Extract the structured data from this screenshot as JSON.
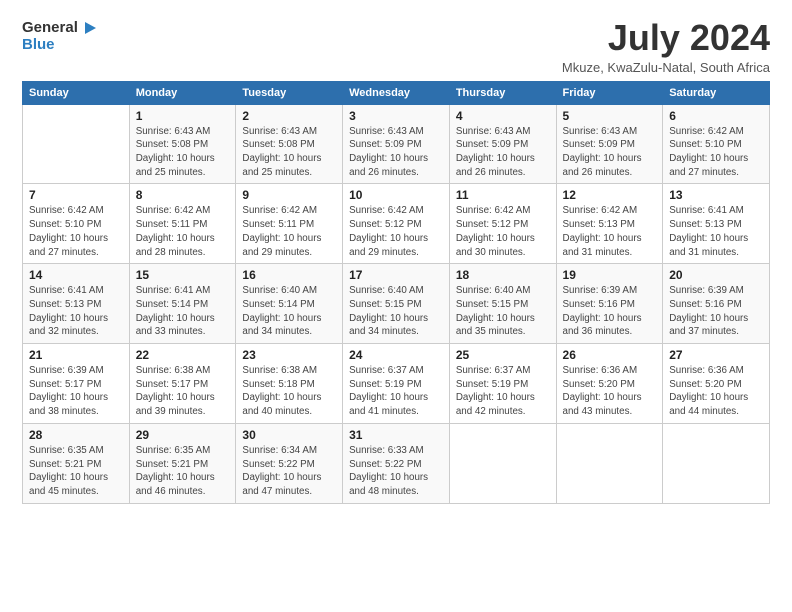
{
  "logo": {
    "line1": "General",
    "line2": "Blue",
    "arrow_color": "#2d7fc1"
  },
  "title": "July 2024",
  "subtitle": "Mkuze, KwaZulu-Natal, South Africa",
  "days_of_week": [
    "Sunday",
    "Monday",
    "Tuesday",
    "Wednesday",
    "Thursday",
    "Friday",
    "Saturday"
  ],
  "weeks": [
    [
      {
        "num": "",
        "info": ""
      },
      {
        "num": "1",
        "info": "Sunrise: 6:43 AM\nSunset: 5:08 PM\nDaylight: 10 hours\nand 25 minutes."
      },
      {
        "num": "2",
        "info": "Sunrise: 6:43 AM\nSunset: 5:08 PM\nDaylight: 10 hours\nand 25 minutes."
      },
      {
        "num": "3",
        "info": "Sunrise: 6:43 AM\nSunset: 5:09 PM\nDaylight: 10 hours\nand 26 minutes."
      },
      {
        "num": "4",
        "info": "Sunrise: 6:43 AM\nSunset: 5:09 PM\nDaylight: 10 hours\nand 26 minutes."
      },
      {
        "num": "5",
        "info": "Sunrise: 6:43 AM\nSunset: 5:09 PM\nDaylight: 10 hours\nand 26 minutes."
      },
      {
        "num": "6",
        "info": "Sunrise: 6:42 AM\nSunset: 5:10 PM\nDaylight: 10 hours\nand 27 minutes."
      }
    ],
    [
      {
        "num": "7",
        "info": "Sunrise: 6:42 AM\nSunset: 5:10 PM\nDaylight: 10 hours\nand 27 minutes."
      },
      {
        "num": "8",
        "info": "Sunrise: 6:42 AM\nSunset: 5:11 PM\nDaylight: 10 hours\nand 28 minutes."
      },
      {
        "num": "9",
        "info": "Sunrise: 6:42 AM\nSunset: 5:11 PM\nDaylight: 10 hours\nand 29 minutes."
      },
      {
        "num": "10",
        "info": "Sunrise: 6:42 AM\nSunset: 5:12 PM\nDaylight: 10 hours\nand 29 minutes."
      },
      {
        "num": "11",
        "info": "Sunrise: 6:42 AM\nSunset: 5:12 PM\nDaylight: 10 hours\nand 30 minutes."
      },
      {
        "num": "12",
        "info": "Sunrise: 6:42 AM\nSunset: 5:13 PM\nDaylight: 10 hours\nand 31 minutes."
      },
      {
        "num": "13",
        "info": "Sunrise: 6:41 AM\nSunset: 5:13 PM\nDaylight: 10 hours\nand 31 minutes."
      }
    ],
    [
      {
        "num": "14",
        "info": "Sunrise: 6:41 AM\nSunset: 5:13 PM\nDaylight: 10 hours\nand 32 minutes."
      },
      {
        "num": "15",
        "info": "Sunrise: 6:41 AM\nSunset: 5:14 PM\nDaylight: 10 hours\nand 33 minutes."
      },
      {
        "num": "16",
        "info": "Sunrise: 6:40 AM\nSunset: 5:14 PM\nDaylight: 10 hours\nand 34 minutes."
      },
      {
        "num": "17",
        "info": "Sunrise: 6:40 AM\nSunset: 5:15 PM\nDaylight: 10 hours\nand 34 minutes."
      },
      {
        "num": "18",
        "info": "Sunrise: 6:40 AM\nSunset: 5:15 PM\nDaylight: 10 hours\nand 35 minutes."
      },
      {
        "num": "19",
        "info": "Sunrise: 6:39 AM\nSunset: 5:16 PM\nDaylight: 10 hours\nand 36 minutes."
      },
      {
        "num": "20",
        "info": "Sunrise: 6:39 AM\nSunset: 5:16 PM\nDaylight: 10 hours\nand 37 minutes."
      }
    ],
    [
      {
        "num": "21",
        "info": "Sunrise: 6:39 AM\nSunset: 5:17 PM\nDaylight: 10 hours\nand 38 minutes."
      },
      {
        "num": "22",
        "info": "Sunrise: 6:38 AM\nSunset: 5:17 PM\nDaylight: 10 hours\nand 39 minutes."
      },
      {
        "num": "23",
        "info": "Sunrise: 6:38 AM\nSunset: 5:18 PM\nDaylight: 10 hours\nand 40 minutes."
      },
      {
        "num": "24",
        "info": "Sunrise: 6:37 AM\nSunset: 5:19 PM\nDaylight: 10 hours\nand 41 minutes."
      },
      {
        "num": "25",
        "info": "Sunrise: 6:37 AM\nSunset: 5:19 PM\nDaylight: 10 hours\nand 42 minutes."
      },
      {
        "num": "26",
        "info": "Sunrise: 6:36 AM\nSunset: 5:20 PM\nDaylight: 10 hours\nand 43 minutes."
      },
      {
        "num": "27",
        "info": "Sunrise: 6:36 AM\nSunset: 5:20 PM\nDaylight: 10 hours\nand 44 minutes."
      }
    ],
    [
      {
        "num": "28",
        "info": "Sunrise: 6:35 AM\nSunset: 5:21 PM\nDaylight: 10 hours\nand 45 minutes."
      },
      {
        "num": "29",
        "info": "Sunrise: 6:35 AM\nSunset: 5:21 PM\nDaylight: 10 hours\nand 46 minutes."
      },
      {
        "num": "30",
        "info": "Sunrise: 6:34 AM\nSunset: 5:22 PM\nDaylight: 10 hours\nand 47 minutes."
      },
      {
        "num": "31",
        "info": "Sunrise: 6:33 AM\nSunset: 5:22 PM\nDaylight: 10 hours\nand 48 minutes."
      },
      {
        "num": "",
        "info": ""
      },
      {
        "num": "",
        "info": ""
      },
      {
        "num": "",
        "info": ""
      }
    ]
  ]
}
